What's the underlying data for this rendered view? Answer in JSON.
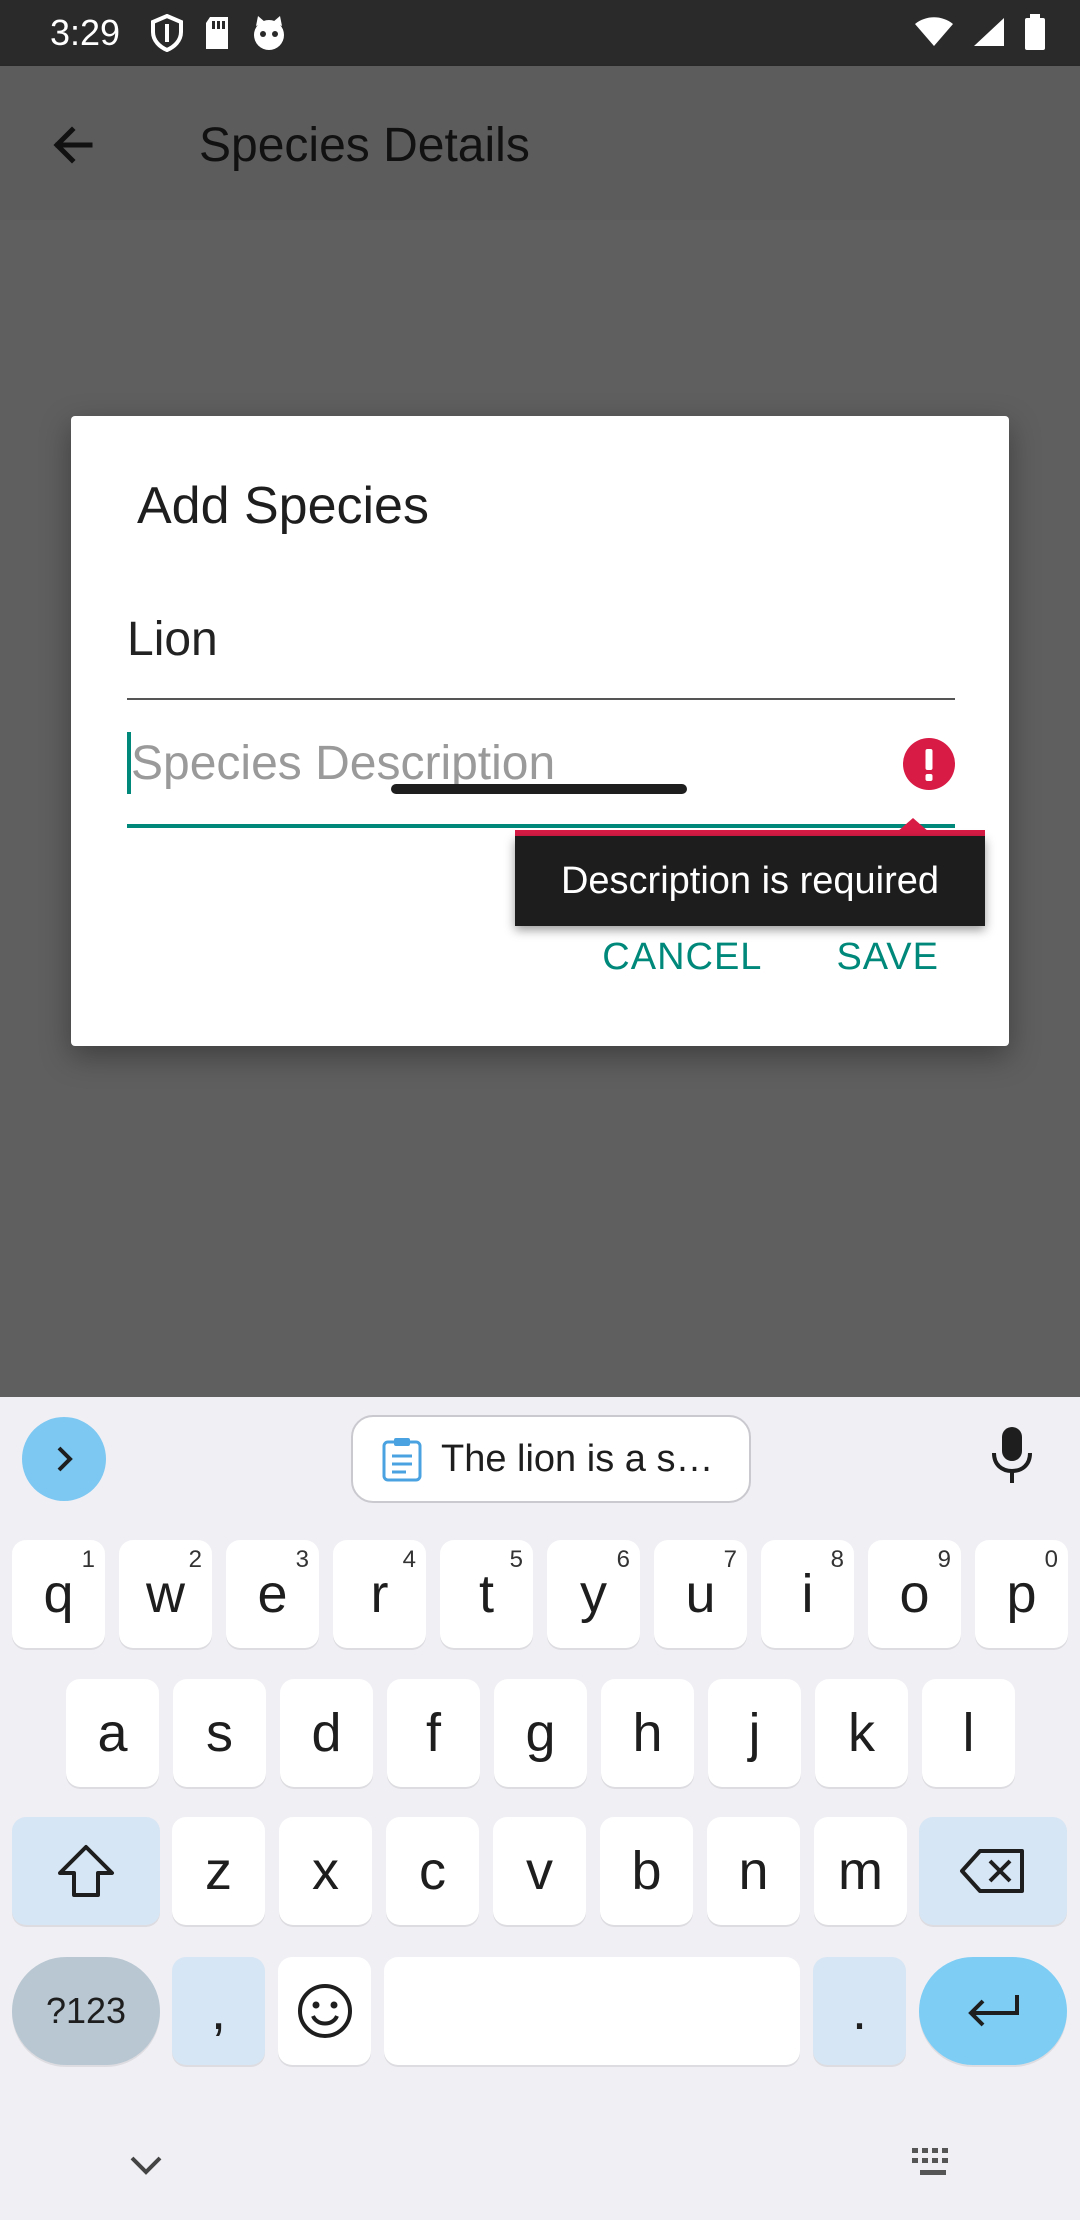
{
  "status_bar": {
    "time": "3:29"
  },
  "app_bar": {
    "title": "Species Details"
  },
  "dialog": {
    "title": "Add Species",
    "name_value": "Lion",
    "description_placeholder": "Species Description",
    "error_text": "Description is required",
    "cancel_label": "CANCEL",
    "save_label": "SAVE"
  },
  "keyboard": {
    "clipboard_suggestion": "The lion is a s…",
    "row1": [
      {
        "key": "q",
        "num": "1"
      },
      {
        "key": "w",
        "num": "2"
      },
      {
        "key": "e",
        "num": "3"
      },
      {
        "key": "r",
        "num": "4"
      },
      {
        "key": "t",
        "num": "5"
      },
      {
        "key": "y",
        "num": "6"
      },
      {
        "key": "u",
        "num": "7"
      },
      {
        "key": "i",
        "num": "8"
      },
      {
        "key": "o",
        "num": "9"
      },
      {
        "key": "p",
        "num": "0"
      }
    ],
    "row2": [
      "a",
      "s",
      "d",
      "f",
      "g",
      "h",
      "j",
      "k",
      "l"
    ],
    "row3": [
      "z",
      "x",
      "c",
      "v",
      "b",
      "n",
      "m"
    ],
    "symbols_label": "?123",
    "comma": ",",
    "period": "."
  },
  "colors": {
    "accent": "#00897b",
    "error": "#d81b45",
    "keyboard_accent": "#7dcdf5"
  }
}
